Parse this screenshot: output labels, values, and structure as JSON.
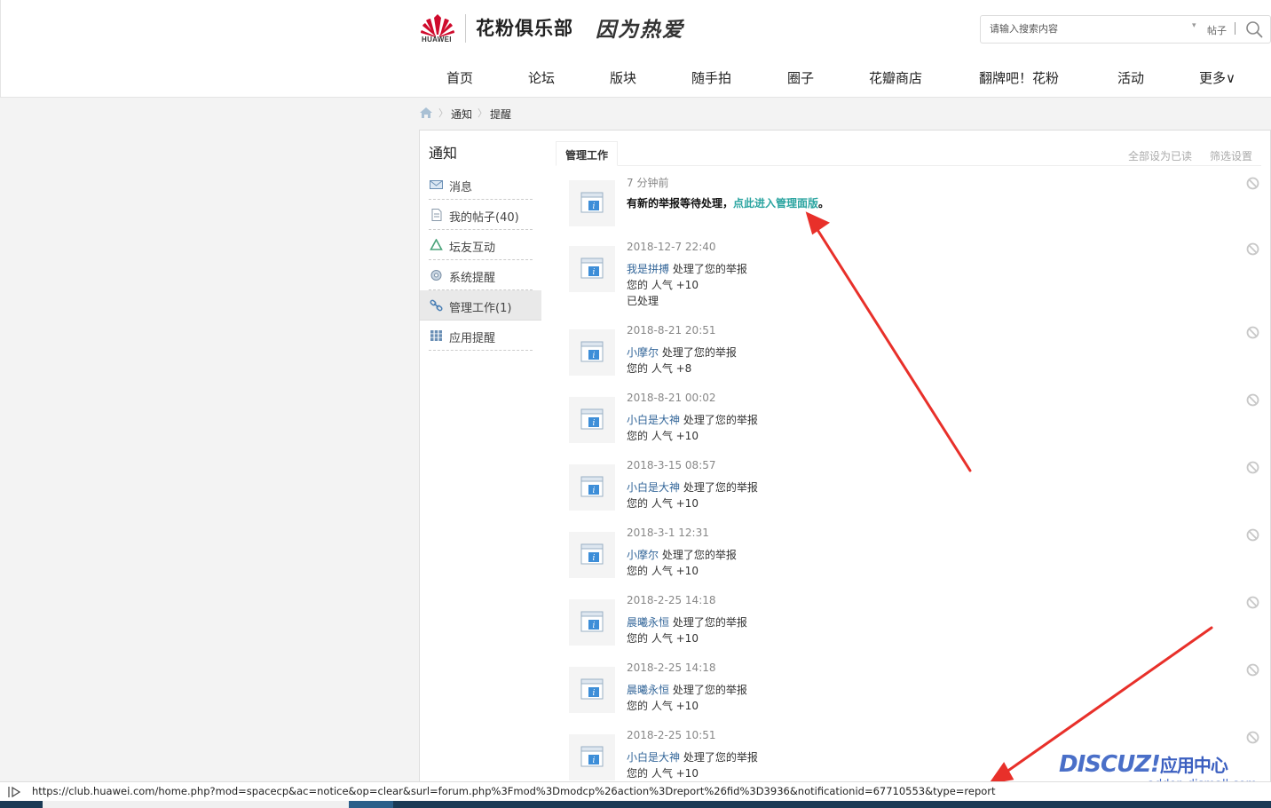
{
  "header": {
    "brand": "HUAWEI",
    "site_title": "花粉俱乐部",
    "slogan": "因为热爱",
    "search": {
      "placeholder": "请输入搜索内容",
      "type_label": "帖子"
    }
  },
  "nav": {
    "items": [
      "首页",
      "论坛",
      "版块",
      "随手拍",
      "圈子",
      "花瓣商店",
      "翻牌吧！花粉",
      "活动",
      "更多∨"
    ]
  },
  "breadcrumb": {
    "items": [
      "通知",
      "提醒"
    ]
  },
  "sidebar": {
    "title": "通知",
    "items": [
      {
        "label": "消息",
        "icon": "envelope-icon"
      },
      {
        "label": "我的帖子(40)",
        "icon": "document-icon"
      },
      {
        "label": "坛友互动",
        "icon": "recycle-icon"
      },
      {
        "label": "系统提醒",
        "icon": "settings-icon"
      },
      {
        "label": "管理工作(1)",
        "icon": "link-icon",
        "active": true
      },
      {
        "label": "应用提醒",
        "icon": "grid-icon"
      }
    ]
  },
  "main": {
    "tab": "管理工作",
    "actions": {
      "mark_all_read": "全部设为已读",
      "filter_settings": "筛选设置"
    },
    "notices": [
      {
        "time": "7 分钟前",
        "first": {
          "pre": "有新的举报等待处理，",
          "link": "点此进入管理面版",
          "post": "。"
        }
      },
      {
        "time": "2018-12-7 22:40",
        "user": "我是拼搏",
        "action": " 处理了您的举报",
        "reward": "您的 人气 +10",
        "extra": "已处理"
      },
      {
        "time": "2018-8-21 20:51",
        "user": "小摩尔",
        "action": " 处理了您的举报",
        "reward": "您的 人气 +8"
      },
      {
        "time": "2018-8-21 00:02",
        "user": "小白是大神",
        "action": " 处理了您的举报",
        "reward": "您的 人气 +10"
      },
      {
        "time": "2018-3-15 08:57",
        "user": "小白是大神",
        "action": " 处理了您的举报",
        "reward": "您的 人气 +10"
      },
      {
        "time": "2018-3-1 12:31",
        "user": "小摩尔",
        "action": " 处理了您的举报",
        "reward": "您的 人气 +10"
      },
      {
        "time": "2018-2-25 14:18",
        "user": "晨曦永恒",
        "action": " 处理了您的举报",
        "reward": "您的 人气 +10"
      },
      {
        "time": "2018-2-25 14:18",
        "user": "晨曦永恒",
        "action": " 处理了您的举报",
        "reward": "您的 人气 +10"
      },
      {
        "time": "2018-2-25 10:51",
        "user": "小白是大神",
        "action": " 处理了您的举报",
        "reward": "您的 人气 +10"
      }
    ]
  },
  "statusbar": {
    "url": "https://club.huawei.com/home.php?mod=spacecp&ac=notice&op=clear&surl=forum.php%3Fmod%3Dmodcp%26action%3Dreport%26fid%3D3936&notificationid=67710553&type=report"
  },
  "watermark": {
    "brand": "DISCUZ!",
    "cn": "应用中心",
    "domain": "addon.dismall.com"
  },
  "colors": {
    "accent_link": "#2aa4a0",
    "user_link": "#336699",
    "annotation_arrow": "#e8302a",
    "huawei_red": "#cf0a2c"
  }
}
